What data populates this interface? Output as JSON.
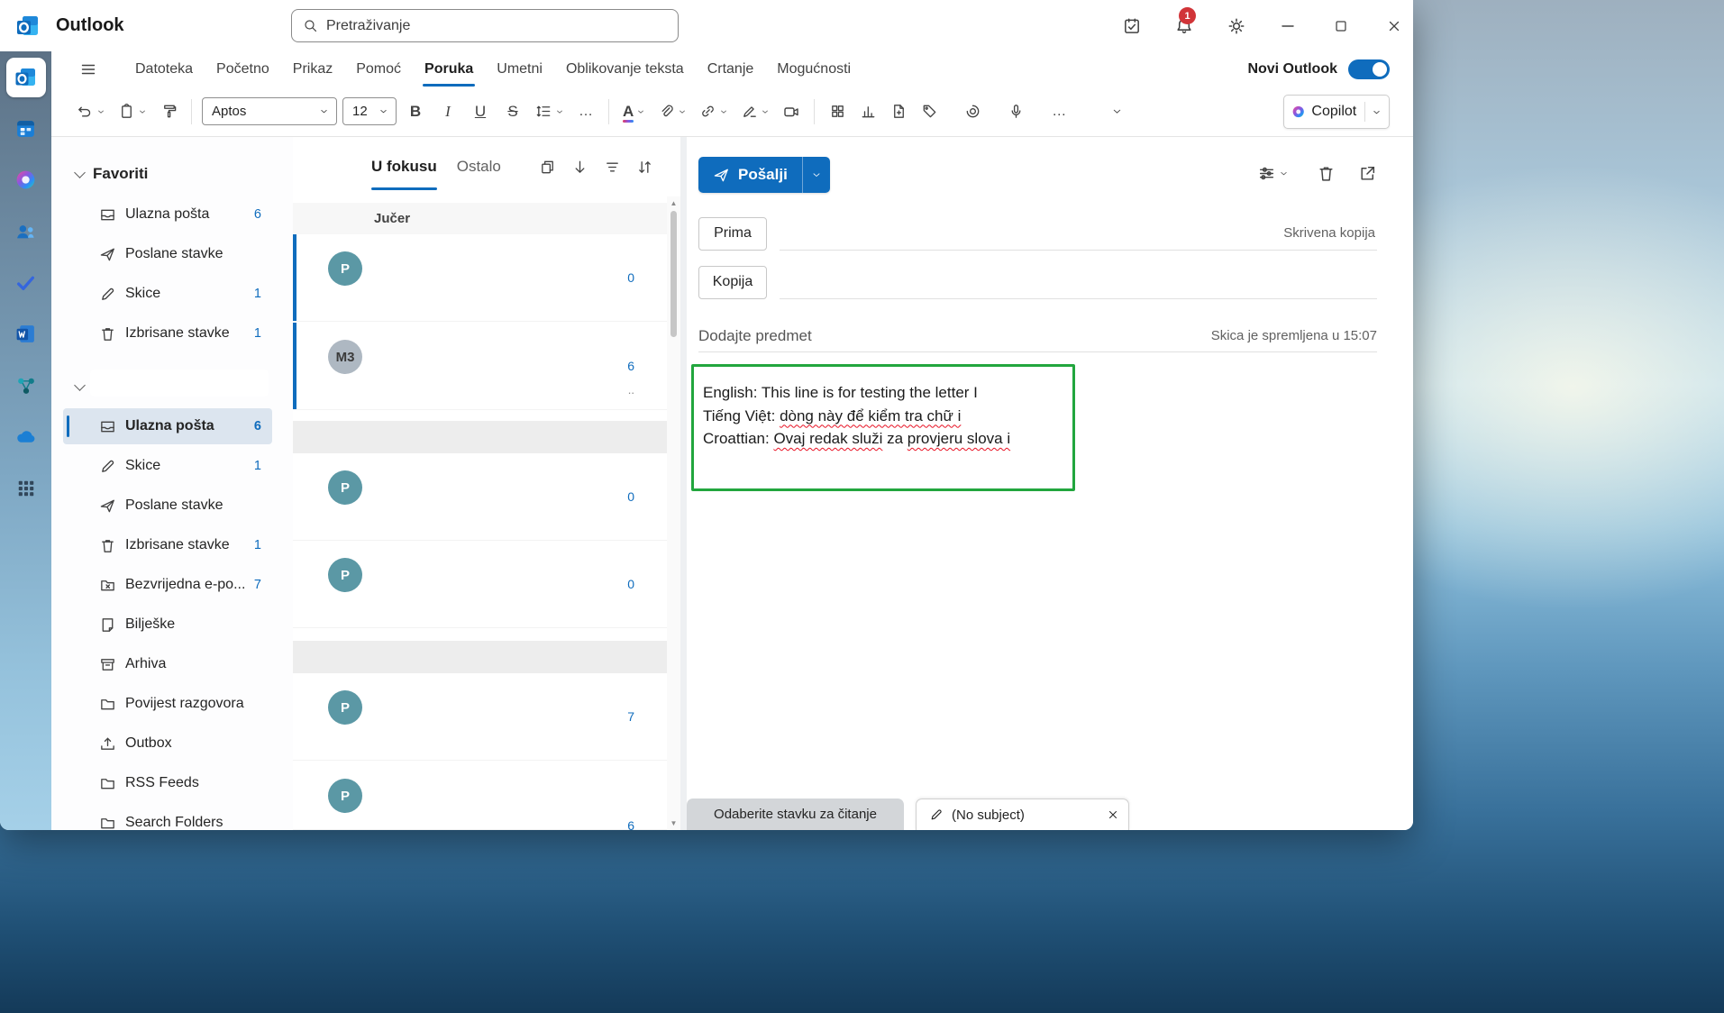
{
  "colors": {
    "accent": "#0f6cbd",
    "annotation_green": "#22a63e",
    "spellcheck_red": "#e81123",
    "badge_red": "#d13438"
  },
  "titlebar": {
    "app_name": "Outlook",
    "search_placeholder": "Pretraživanje",
    "notification_badge": "1"
  },
  "ribbon": {
    "tabs": [
      {
        "label": "Datoteka"
      },
      {
        "label": "Početno"
      },
      {
        "label": "Prikaz"
      },
      {
        "label": "Pomoć"
      },
      {
        "label": "Poruka"
      },
      {
        "label": "Umetni"
      },
      {
        "label": "Oblikovanje teksta"
      },
      {
        "label": "Crtanje"
      },
      {
        "label": "Mogućnosti"
      }
    ],
    "active_tab": "Poruka",
    "new_outlook_label": "Novi Outlook",
    "font_name": "Aptos",
    "font_size": "12",
    "bold_label": "B",
    "italic_label": "I",
    "underline_label": "U",
    "strikethrough_label": "S",
    "text_effects_label": "A",
    "more_label": "…",
    "copilot_label": "Copilot"
  },
  "sidebar": {
    "favorites_header": "Favoriti",
    "favorites": [
      {
        "label": "Ulazna pošta",
        "count": "6"
      },
      {
        "label": "Poslane stavke",
        "count": ""
      },
      {
        "label": "Skice",
        "count": "1"
      },
      {
        "label": "Izbrisane stavke",
        "count": "1"
      }
    ],
    "account": [
      {
        "label": "Ulazna pošta",
        "count": "6"
      },
      {
        "label": "Skice",
        "count": "1"
      },
      {
        "label": "Poslane stavke",
        "count": ""
      },
      {
        "label": "Izbrisane stavke",
        "count": "1"
      },
      {
        "label": "Bezvrijedna e-po...",
        "count": "7"
      },
      {
        "label": "Bilješke",
        "count": ""
      },
      {
        "label": "Arhiva",
        "count": ""
      },
      {
        "label": "Povijest razgovora",
        "count": ""
      },
      {
        "label": "Outbox",
        "count": ""
      },
      {
        "label": "RSS Feeds",
        "count": ""
      },
      {
        "label": "Search Folders",
        "count": ""
      }
    ]
  },
  "message_list": {
    "focused_tab": "U fokusu",
    "other_tab": "Ostalo",
    "group_header": "Jučer",
    "rows": [
      {
        "avatar": "P",
        "time_fragment": "0"
      },
      {
        "avatar": "M3",
        "time_fragment": "6",
        "sub_fragment": ".."
      },
      {
        "avatar": "P",
        "time_fragment": "0"
      },
      {
        "avatar": "P",
        "time_fragment": "0"
      },
      {
        "avatar": "P",
        "time_fragment": "7"
      },
      {
        "avatar": "P",
        "time_fragment": "6"
      }
    ]
  },
  "compose": {
    "send_label": "Pošalji",
    "to_label": "Prima",
    "cc_label": "Kopija",
    "bcc_label": "Skrivena kopija",
    "subject_placeholder": "Dodajte predmet",
    "draft_status": "Skica je spremljena u 15:07",
    "body_line1_prefix": "English: ",
    "body_line1": "This line is for testing the letter I",
    "body_line2_prefix": "Tiếng Việt: ",
    "body_line2": "dòng này để kiểm tra chữ i",
    "body_line3_prefix": "Croattian: ",
    "body_line3_seg1": "Ovaj redak služi",
    "body_line3_mid": " za ",
    "body_line3_seg2": "provjeru slova i"
  },
  "bottom_bar": {
    "reading_tab": "Odaberite stavku za čitanje",
    "draft_tab": "(No subject)"
  }
}
